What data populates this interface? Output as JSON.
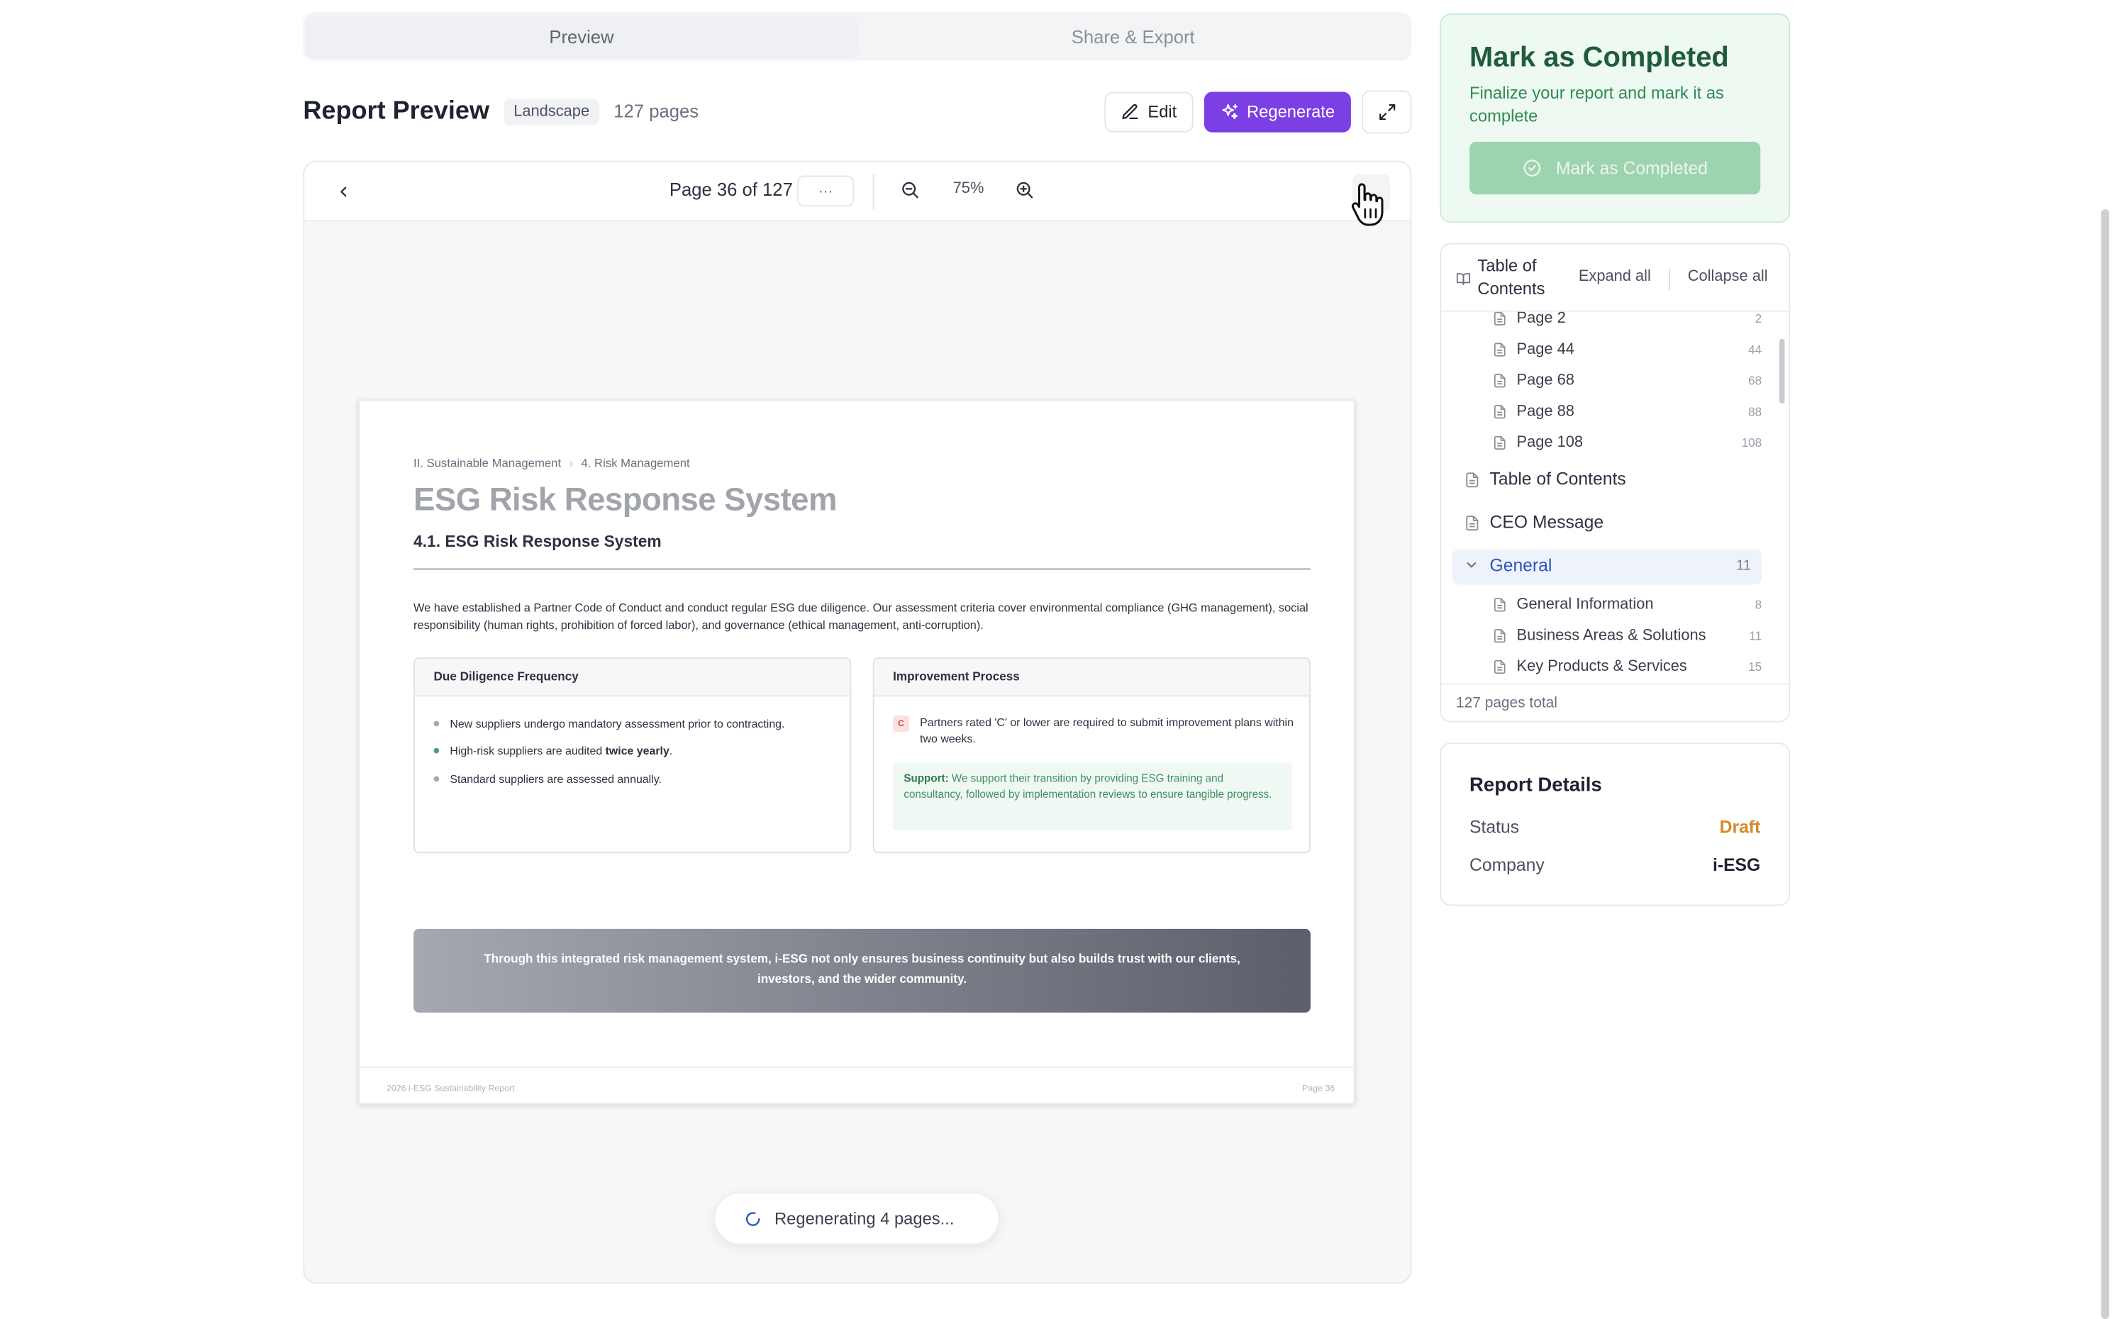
{
  "tabs": [
    {
      "label": "Preview",
      "active": true
    },
    {
      "label": "Share & Export",
      "active": false
    }
  ],
  "header": {
    "title": "Report Preview",
    "orientation_badge": "Landscape",
    "page_count": "127 pages",
    "edit_label": "Edit",
    "regenerate_label": "Regenerate"
  },
  "toolbar": {
    "page_indicator": "Page 36 of 127",
    "more_label": "···",
    "zoom": "75%"
  },
  "document": {
    "breadcrumb": [
      "II. Sustainable Management",
      "4. Risk Management"
    ],
    "title": "ESG Risk Response System",
    "subtitle": "4.1. ESG Risk Response System",
    "body": "We have established a Partner Code of Conduct and conduct regular ESG due diligence. Our assessment criteria cover environmental compliance (GHG management), social responsibility (human rights, prohibition of forced labor), and governance (ethical management, anti-corruption).",
    "due_diligence": {
      "heading": "Due Diligence Frequency",
      "items": [
        "New suppliers undergo mandatory assessment prior to contracting.",
        "High-risk suppliers are audited ",
        "Standard suppliers are assessed annually."
      ],
      "bold_fragment": "twice yearly",
      "trailing": "."
    },
    "improvement": {
      "heading": "Improvement Process",
      "badge": "C",
      "text": "Partners rated 'C' or lower are required to submit improvement plans within two weeks.",
      "support_label": "Support:",
      "support_text": " We support their transition by providing ESG training and consultancy, followed by implementation reviews to ensure tangible progress."
    },
    "banner": "Through this integrated risk management system, i-ESG not only ensures business continuity but also builds trust with our clients, investors, and the wider community.",
    "footer_left": "2026 i-ESG Sustainability Report",
    "footer_right": "Page 36"
  },
  "regenerating": "Regenerating 4 pages...",
  "mark_completed": {
    "title": "Mark as Completed",
    "description": "Finalize your report and mark it as complete",
    "button": "Mark as Completed"
  },
  "toc": {
    "title": "Table of Contents",
    "expand_all": "Expand all",
    "collapse_all": "Collapse all",
    "sub_items_top": [
      {
        "label": "Page 2",
        "num": "2"
      },
      {
        "label": "Page 44",
        "num": "44"
      },
      {
        "label": "Page 68",
        "num": "68"
      },
      {
        "label": "Page 88",
        "num": "88"
      },
      {
        "label": "Page 108",
        "num": "108"
      }
    ],
    "sections": [
      {
        "label": "Table of Contents"
      },
      {
        "label": "CEO Message"
      },
      {
        "label": "General",
        "num": "11",
        "active": true
      }
    ],
    "general_items": [
      {
        "label": "General Information",
        "num": "8"
      },
      {
        "label": "Business Areas & Solutions",
        "num": "11"
      },
      {
        "label": "Key Products & Services",
        "num": "15"
      }
    ],
    "footer": "127 pages total"
  },
  "details": {
    "title": "Report Details",
    "status_label": "Status",
    "status_value": "Draft",
    "company_label": "Company",
    "company_value": "i-ESG"
  },
  "colors": {
    "accent": "#7b3fe4",
    "success": "#2f8a56",
    "draft": "#d48a25",
    "active_link": "#2b55b8"
  }
}
